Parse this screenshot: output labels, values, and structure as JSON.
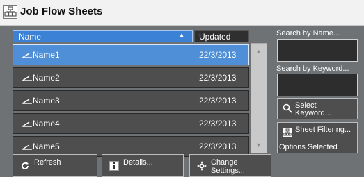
{
  "window": {
    "title": "Job Flow Sheets"
  },
  "list": {
    "header_name": "Name",
    "header_updated": "Updated",
    "rows": [
      {
        "name": "Name1",
        "date": "22/3/2013",
        "selected": true
      },
      {
        "name": "Name2",
        "date": "22/3/2013"
      },
      {
        "name": "Name3",
        "date": "22/3/2013"
      },
      {
        "name": "Name4",
        "date": "22/3/2013"
      },
      {
        "name": "Name5",
        "date": "22/3/2013"
      }
    ]
  },
  "side": {
    "search_by_name": "Search by Name...",
    "search_by_keyword": "Search by Keyword...",
    "select_keyword_1": "Select",
    "select_keyword_2": "Keyword...",
    "sheet_filtering": "Sheet Filtering...",
    "options_selected": "Options Selected"
  },
  "buttons": {
    "refresh": "Refresh",
    "details": "Details...",
    "change_1": "Change",
    "change_2": "Settings..."
  }
}
